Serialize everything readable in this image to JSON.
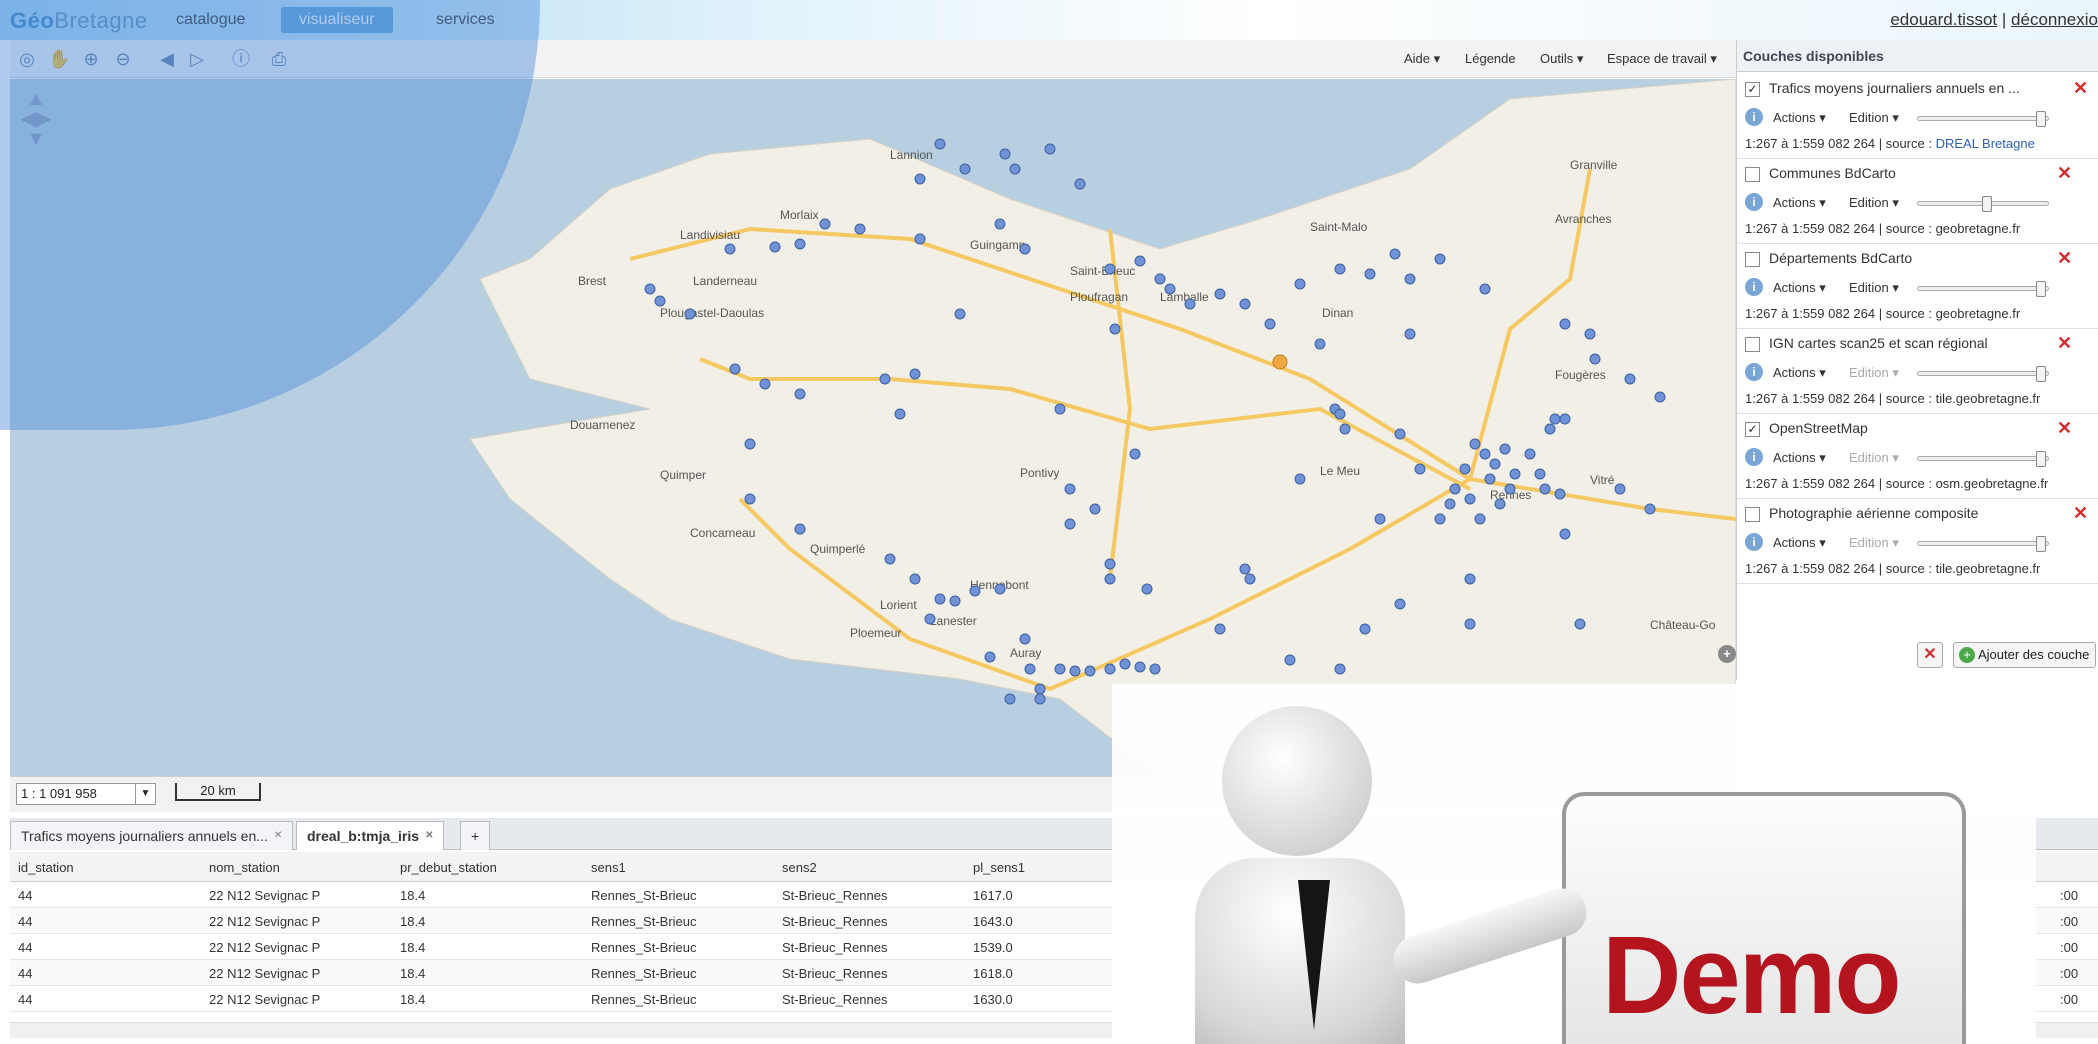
{
  "header": {
    "logo_geo": "Géo",
    "logo_rest": "Bretagne",
    "nav": [
      "catalogue",
      "visualiseur",
      "services"
    ],
    "user": "edouard.tissot",
    "sep": "|",
    "logout": "déconnexio"
  },
  "toolbar": {
    "aide": "Aide ▾",
    "legende": "Légende",
    "outils": "Outils ▾",
    "espace": "Espace de travail ▾"
  },
  "map": {
    "places": [
      "Lannion",
      "Morlaix",
      "Guingamp",
      "Landivisiau",
      "Brest",
      "Landerneau",
      "Plougastel-Daoulas",
      "Saint-Brieuc",
      "Ploufragan",
      "Lamballe",
      "Saint-Malo",
      "Dinan",
      "Douarnenez",
      "Quimper",
      "Concarneau",
      "Quimperlé",
      "Pontivy",
      "Hennebont",
      "Lorient",
      "Lanester",
      "Ploemeur",
      "Auray",
      "Rennes",
      "Vitré",
      "Fougères",
      "Avranches",
      "Granville",
      "Château-Go",
      "Le Meu"
    ],
    "scale_value": "1 : 1 091 958",
    "scalebar_label": "20 km"
  },
  "layers_panel": {
    "title": "Couches disponibles",
    "layers": [
      {
        "name": "Trafics moyens journaliers annuels en ...",
        "checked": true,
        "actions": "Actions ▾",
        "edition": "Edition ▾",
        "meta_prefix": "1:267 à 1:559 082 264 | source : ",
        "source": "DREAL Bretagne"
      },
      {
        "name": "Communes BdCarto",
        "checked": false,
        "actions": "Actions ▾",
        "edition": "Edition ▾",
        "meta_prefix": "1:267 à 1:559 082 264 | source : ",
        "source": "geobretagne.fr"
      },
      {
        "name": "Départements BdCarto",
        "checked": false,
        "actions": "Actions ▾",
        "edition": "Edition ▾",
        "meta_prefix": "1:267 à 1:559 082 264 | source : ",
        "source": "geobretagne.fr"
      },
      {
        "name": "IGN cartes scan25 et scan régional",
        "checked": false,
        "actions": "Actions ▾",
        "edition": "Edition ▾",
        "meta_prefix": "1:267 à 1:559 082 264 | source : ",
        "source": "tile.geobretagne.fr"
      },
      {
        "name": "OpenStreetMap",
        "checked": true,
        "actions": "Actions ▾",
        "edition": "Edition ▾",
        "meta_prefix": "1:267 à 1:559 082 264 | source : ",
        "source": "osm.geobretagne.fr"
      },
      {
        "name": "Photographie aérienne composite",
        "checked": false,
        "actions": "Actions ▾",
        "edition": "Edition ▾",
        "meta_prefix": "1:267 à 1:559 082 264 | source : ",
        "source": "tile.geobretagne.fr"
      }
    ],
    "add_button": "Ajouter des couche"
  },
  "tabs": {
    "tab1": "Trafics moyens journaliers annuels en...",
    "tab2": "dreal_b:tmja_iris",
    "add": "+"
  },
  "grid": {
    "columns": [
      "id_station",
      "nom_station",
      "pr_debut_station",
      "sens1",
      "sens2",
      "pl_sens1"
    ],
    "rows": [
      [
        "44",
        "22 N12 Sevignac P",
        "18.4",
        "Rennes_St-Brieuc",
        "St-Brieuc_Rennes",
        "1617.0"
      ],
      [
        "44",
        "22 N12 Sevignac P",
        "18.4",
        "Rennes_St-Brieuc",
        "St-Brieuc_Rennes",
        "1643.0"
      ],
      [
        "44",
        "22 N12 Sevignac P",
        "18.4",
        "Rennes_St-Brieuc",
        "St-Brieuc_Rennes",
        "1539.0"
      ],
      [
        "44",
        "22 N12 Sevignac P",
        "18.4",
        "Rennes_St-Brieuc",
        "St-Brieuc_Rennes",
        "1618.0"
      ],
      [
        "44",
        "22 N12 Sevignac P",
        "18.4",
        "Rennes_St-Brieuc",
        "St-Brieuc_Rennes",
        "1630.0"
      ]
    ],
    "edge_values": [
      ":00",
      ":00",
      ":00",
      ":00",
      ":00"
    ]
  },
  "overlay": {
    "demo": "Demo"
  },
  "colors": {
    "accent": "#5ba3d6",
    "point": "#6f93d6",
    "delete": "#d62b2b",
    "demo": "#b4141e"
  }
}
